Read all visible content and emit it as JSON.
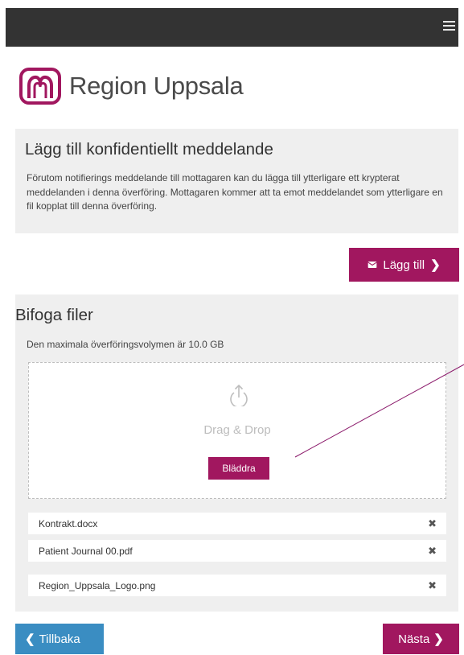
{
  "header": {
    "menu_icon": "hamburger-menu-icon"
  },
  "brand": {
    "name": "Region Uppsala",
    "color": "#a1175f"
  },
  "confidential": {
    "title": "Lägg till konfidentiellt meddelande",
    "description": "Förutom notifierings meddelande till mottagaren kan du lägga till ytterligare ett krypterat meddelanden i denna överföring. Mottagaren kommer att ta emot meddelandet som ytterligare en fil kopplat till denna överföring.",
    "add_button": "Lägg till",
    "add_icon": "envelope-icon"
  },
  "attach": {
    "title": "Bifoga filer",
    "limit_text": "Den maximala överföringsvolymen är 10.0 GB",
    "drop_text": "Drag & Drop",
    "browse_button": "Bläddra",
    "files": [
      {
        "name": "Kontrakt.docx"
      },
      {
        "name": "Patient Journal 00.pdf"
      },
      {
        "name": "Region_Uppsala_Logo.png"
      }
    ]
  },
  "nav": {
    "back_label": "Tillbaka",
    "next_label": "Nästa"
  },
  "colors": {
    "primary": "#a1175f",
    "back": "#3a8dc2",
    "topbar": "#333333",
    "panel": "#efefef"
  }
}
